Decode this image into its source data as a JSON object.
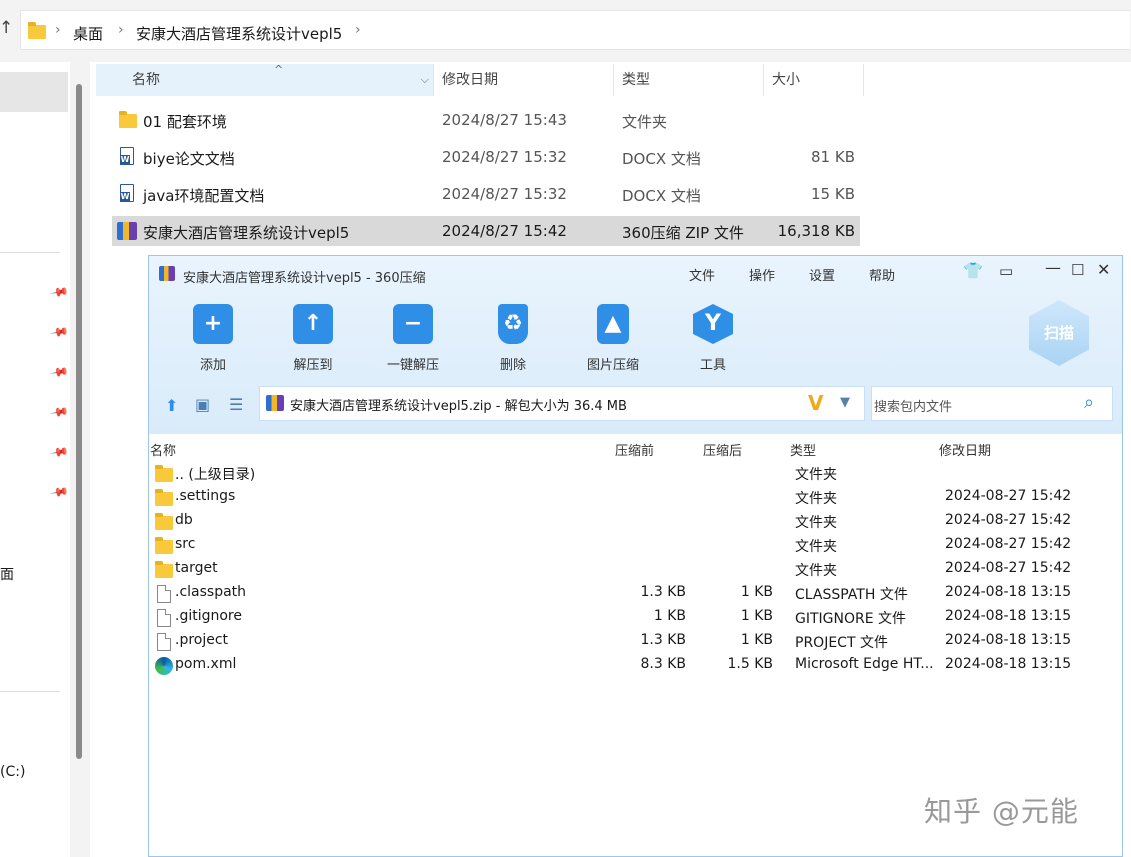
{
  "explorer": {
    "breadcrumb": [
      "桌面",
      "安康大酒店管理系统设计vepl5"
    ],
    "columns": [
      "名称",
      "修改日期",
      "类型",
      "大小"
    ],
    "rows": [
      {
        "name": "01 配套环境",
        "date": "2024/8/27 15:43",
        "type": "文件夹",
        "size": "",
        "icon": "folder-icon"
      },
      {
        "name": "biye论文文档",
        "date": "2024/8/27 15:32",
        "type": "DOCX 文档",
        "size": "81 KB",
        "icon": "word-doc-icon"
      },
      {
        "name": "java环境配置文档",
        "date": "2024/8/27 15:32",
        "type": "DOCX 文档",
        "size": "15 KB",
        "icon": "word-doc-icon"
      },
      {
        "name": "安康大酒店管理系统设计vepl5",
        "date": "2024/8/27 15:42",
        "type": "360压缩 ZIP 文件",
        "size": "16,318 KB",
        "icon": "zip-archive-icon"
      }
    ],
    "nav": {
      "desktop_short": "面",
      "drive": "(C:)"
    }
  },
  "zipwin": {
    "title": "安康大酒店管理系统设计vepl5 - 360压缩",
    "menu": [
      "文件",
      "操作",
      "设置",
      "帮助"
    ],
    "toolbar": [
      "添加",
      "解压到",
      "一键解压",
      "删除",
      "图片压缩",
      "工具"
    ],
    "scan_label": "扫描",
    "path": "安康大酒店管理系统设计vepl5.zip - 解包大小为 36.4 MB",
    "search_placeholder": "搜索包内文件",
    "columns": [
      "名称",
      "压缩前",
      "压缩后",
      "类型",
      "修改日期"
    ],
    "rows": [
      {
        "name": ".. (上级目录)",
        "before": "",
        "after": "",
        "type": "文件夹",
        "date": "",
        "icon": "folder-icon"
      },
      {
        "name": ".settings",
        "before": "",
        "after": "",
        "type": "文件夹",
        "date": "2024-08-27 15:42",
        "icon": "folder-icon"
      },
      {
        "name": "db",
        "before": "",
        "after": "",
        "type": "文件夹",
        "date": "2024-08-27 15:42",
        "icon": "folder-icon"
      },
      {
        "name": "src",
        "before": "",
        "after": "",
        "type": "文件夹",
        "date": "2024-08-27 15:42",
        "icon": "folder-icon"
      },
      {
        "name": "target",
        "before": "",
        "after": "",
        "type": "文件夹",
        "date": "2024-08-27 15:42",
        "icon": "folder-icon"
      },
      {
        "name": ".classpath",
        "before": "1.3 KB",
        "after": "1 KB",
        "type": "CLASSPATH 文件",
        "date": "2024-08-18 13:15",
        "icon": "file-icon"
      },
      {
        "name": ".gitignore",
        "before": "1 KB",
        "after": "1 KB",
        "type": "GITIGNORE 文件",
        "date": "2024-08-18 13:15",
        "icon": "file-icon"
      },
      {
        "name": ".project",
        "before": "1.3 KB",
        "after": "1 KB",
        "type": "PROJECT 文件",
        "date": "2024-08-18 13:15",
        "icon": "file-icon"
      },
      {
        "name": "pom.xml",
        "before": "8.3 KB",
        "after": "1.5 KB",
        "type": "Microsoft Edge HT...",
        "date": "2024-08-18 13:15",
        "icon": "edge-icon"
      }
    ]
  },
  "watermark": "知乎 @元能"
}
